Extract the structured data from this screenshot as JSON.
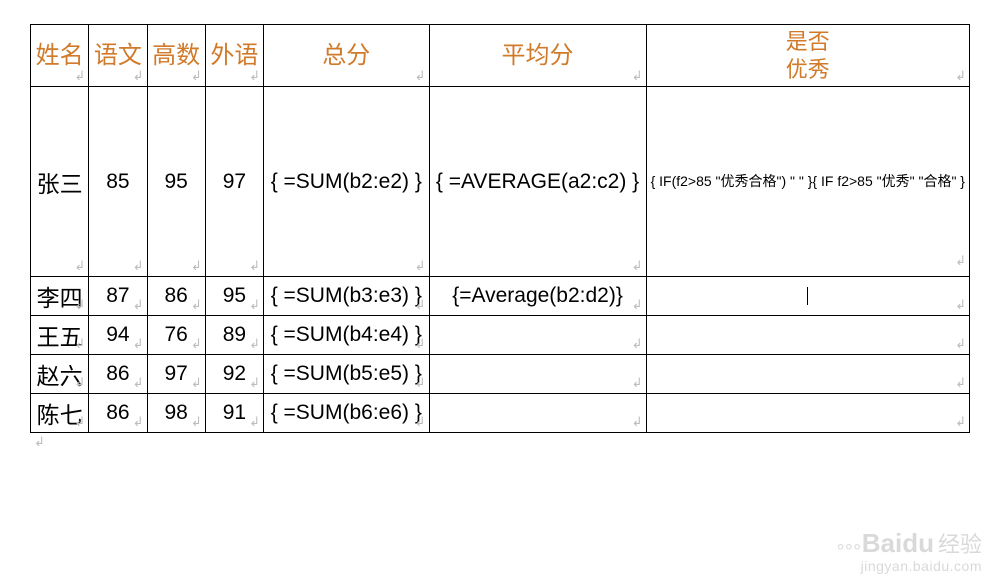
{
  "placeholder_glyph": "↲",
  "headers": {
    "name": "姓名",
    "chinese": "语文",
    "math": "高数",
    "foreign": "外语",
    "total": "总分",
    "average": "平均分",
    "excellent": "是否\n优秀"
  },
  "rows": [
    {
      "name": "张三",
      "chinese": "85",
      "math": "95",
      "foreign": "97",
      "total": "{  =SUM(b2:e2)  }",
      "average": "{  =AVERAGE(a2:c2)  }",
      "excellent": "{ IF(f2>85 \"优秀合格\") \" \" }{ IF  f2>85 \"优秀\" \"合格\" }"
    },
    {
      "name": "李四",
      "chinese": "87",
      "math": "86",
      "foreign": "95",
      "total": "{  =SUM(b3:e3)  }",
      "average": "{=Average(b2:d2)}",
      "excellent": ""
    },
    {
      "name": "王五",
      "chinese": "94",
      "math": "76",
      "foreign": "89",
      "total": "{  =SUM(b4:e4)  }",
      "average": "",
      "excellent": ""
    },
    {
      "name": "赵六",
      "chinese": "86",
      "math": "97",
      "foreign": "92",
      "total": "{  =SUM(b5:e5)  }",
      "average": "",
      "excellent": ""
    },
    {
      "name": "陈七",
      "chinese": "86",
      "math": "98",
      "foreign": "91",
      "total": "{  =SUM(b6:e6)  }",
      "average": "",
      "excellent": ""
    }
  ],
  "watermark": {
    "brand": "Baidu",
    "cn": "经验",
    "url": "jingyan.baidu.com"
  }
}
